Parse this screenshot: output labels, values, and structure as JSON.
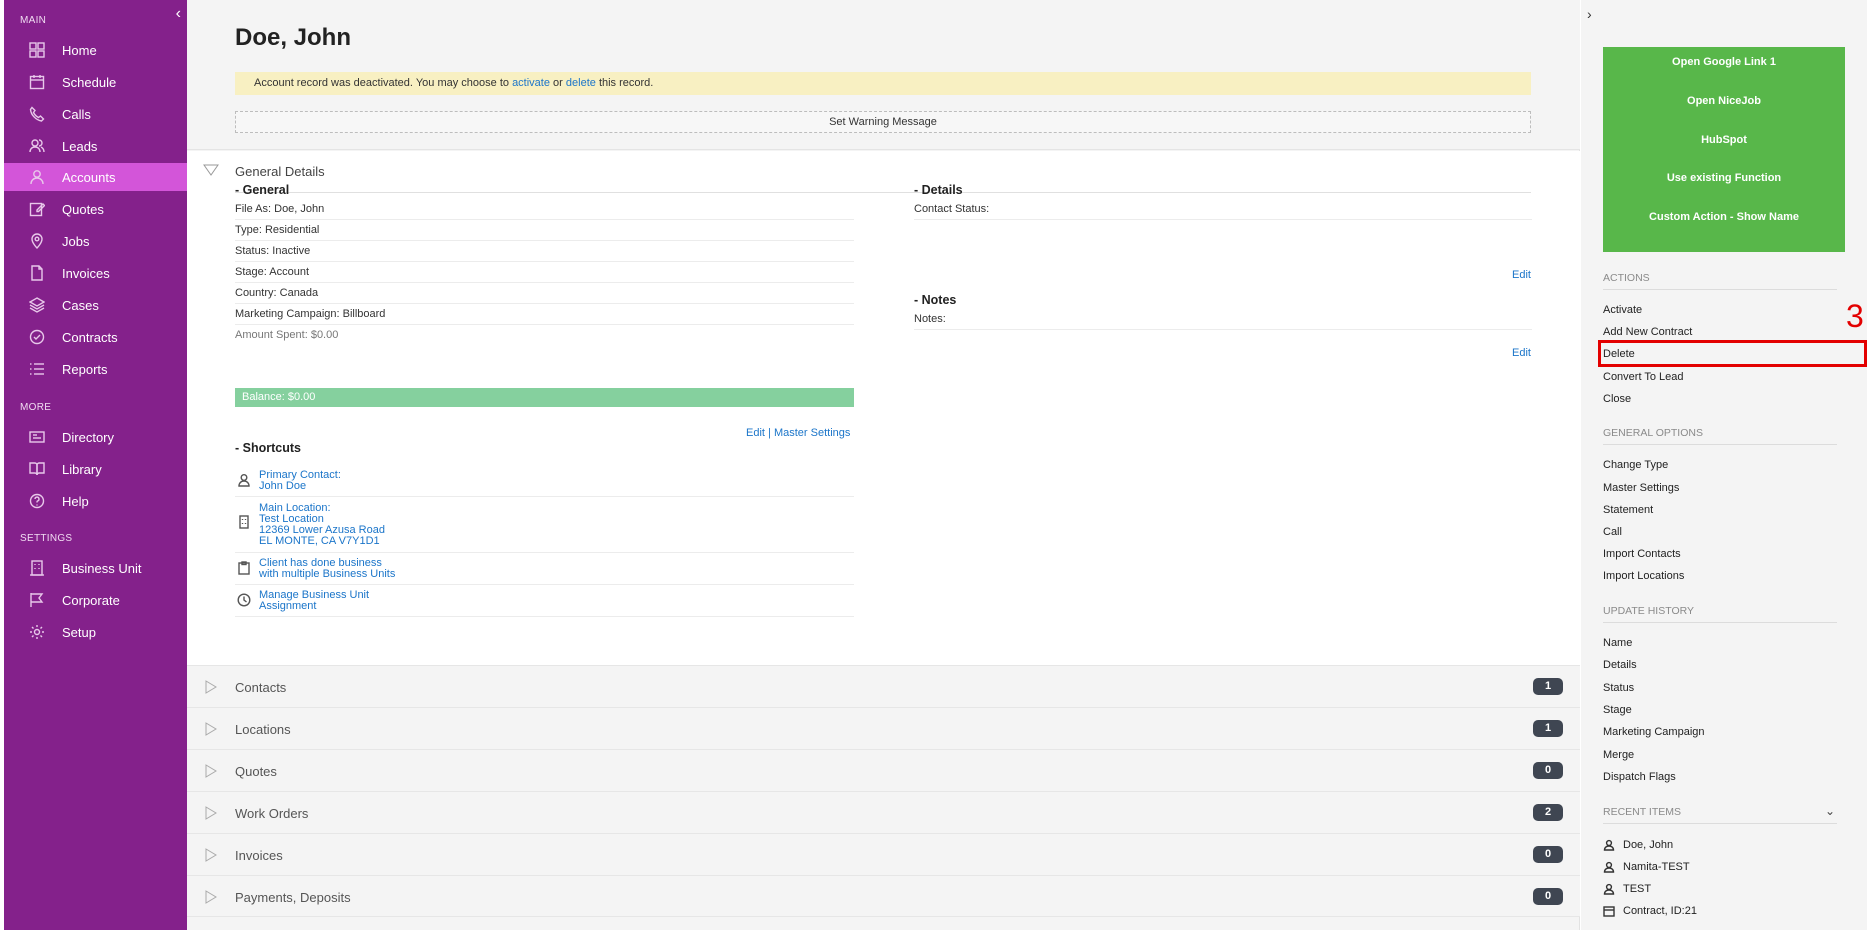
{
  "sidebar": {
    "sections": {
      "main": "MAIN",
      "more": "MORE",
      "settings": "SETTINGS"
    },
    "main_items": [
      "Home",
      "Schedule",
      "Calls",
      "Leads",
      "Accounts",
      "Quotes",
      "Jobs",
      "Invoices",
      "Cases",
      "Contracts",
      "Reports"
    ],
    "more_items": [
      "Directory",
      "Library",
      "Help"
    ],
    "settings_items": [
      "Business Unit",
      "Corporate",
      "Setup"
    ],
    "active": "Accounts",
    "colors": {
      "background": "#84218b",
      "active": "#d355d9"
    }
  },
  "header": {
    "title": "Doe, John",
    "alert": {
      "pre": "Account record was deactivated. You may choose to",
      "activate": "activate",
      "or": "or",
      "delete": "delete",
      "post": "this record."
    },
    "warning_button": "Set Warning Message"
  },
  "general_details": {
    "title": "General  Details",
    "general": {
      "heading": "- General",
      "fields": [
        "File As: Doe, John",
        "Type: Residential",
        "Status: Inactive",
        "Stage: Account",
        "Country: Canada",
        "Marketing Campaign: Billboard"
      ],
      "amount_spent": "Amount Spent: $0.00",
      "balance": "Balance: $0.00",
      "edit": "Edit",
      "separator": "|",
      "master_settings": "Master Settings"
    },
    "details": {
      "heading": "- Details",
      "contact_status": "Contact Status:",
      "edit": "Edit"
    },
    "notes": {
      "heading": "- Notes",
      "notes": "Notes:",
      "edit": "Edit"
    },
    "shortcuts": {
      "heading": "- Shortcuts",
      "primary_contact": [
        "Primary Contact:",
        "John Doe"
      ],
      "main_location": [
        "Main Location:",
        "Test Location",
        "12369 Lower Azusa Road",
        "EL MONTE, CA V7Y1D1"
      ],
      "client_business": [
        "Client has done business",
        "with multiple Business Units"
      ],
      "manage_bu": [
        "Manage Business Unit",
        "Assignment"
      ]
    }
  },
  "sections": [
    {
      "name": "Contacts",
      "count": "1"
    },
    {
      "name": "Locations",
      "count": "1"
    },
    {
      "name": "Quotes",
      "count": "0"
    },
    {
      "name": "Work Orders",
      "count": "2"
    },
    {
      "name": "Invoices",
      "count": "0"
    },
    {
      "name": "Payments, Deposits",
      "count": "0"
    }
  ],
  "right_panel": {
    "custom_buttons": [
      "Open Google Link 1",
      "Open NiceJob",
      "HubSpot",
      "Use existing Function",
      "Custom Action - Show Name"
    ],
    "actions_heading": "ACTIONS",
    "actions": [
      "Activate",
      "Add New Contract",
      "Delete",
      "Convert To Lead",
      "Close"
    ],
    "general_options_heading": "GENERAL OPTIONS",
    "general_options": [
      "Change Type",
      "Master Settings",
      "Statement",
      "Call",
      "Import Contacts",
      "Import Locations"
    ],
    "update_history_heading": "UPDATE HISTORY",
    "update_history": [
      "Name",
      "Details",
      "Status",
      "Stage",
      "Marketing Campaign",
      "Merge",
      "Dispatch Flags"
    ],
    "recent_items_heading": "RECENT ITEMS",
    "recent_items": [
      "Doe, John",
      "Namita-TEST",
      "TEST",
      "Contract, ID:21"
    ],
    "green_color": "#58b74a"
  },
  "annotation": {
    "label": "3",
    "color": "#e30000"
  }
}
